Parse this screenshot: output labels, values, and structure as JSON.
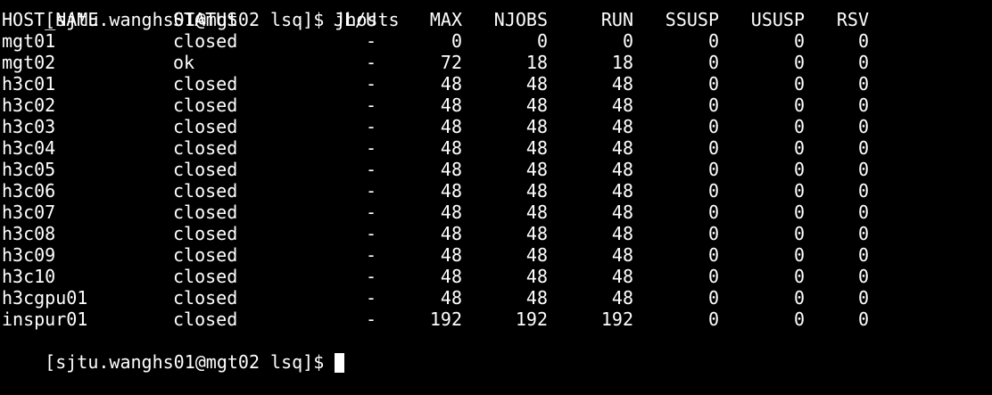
{
  "terminal": {
    "prev_prompt": "[sjtu.wanghs01@mgt02 lsq]$ jhosts",
    "headers": {
      "host_name": "HOST_NAME",
      "status": "STATUS",
      "jlu": "JL/U",
      "max": "MAX",
      "njobs": "NJOBS",
      "run": "RUN",
      "ssusp": "SSUSP",
      "ususp": "USUSP",
      "rsv": "RSV"
    },
    "rows": [
      {
        "host_name": "mgt01",
        "status": "closed",
        "jlu": "-",
        "max": "0",
        "njobs": "0",
        "run": "0",
        "ssusp": "0",
        "ususp": "0",
        "rsv": "0"
      },
      {
        "host_name": "mgt02",
        "status": "ok",
        "jlu": "-",
        "max": "72",
        "njobs": "18",
        "run": "18",
        "ssusp": "0",
        "ususp": "0",
        "rsv": "0"
      },
      {
        "host_name": "h3c01",
        "status": "closed",
        "jlu": "-",
        "max": "48",
        "njobs": "48",
        "run": "48",
        "ssusp": "0",
        "ususp": "0",
        "rsv": "0"
      },
      {
        "host_name": "h3c02",
        "status": "closed",
        "jlu": "-",
        "max": "48",
        "njobs": "48",
        "run": "48",
        "ssusp": "0",
        "ususp": "0",
        "rsv": "0"
      },
      {
        "host_name": "h3c03",
        "status": "closed",
        "jlu": "-",
        "max": "48",
        "njobs": "48",
        "run": "48",
        "ssusp": "0",
        "ususp": "0",
        "rsv": "0"
      },
      {
        "host_name": "h3c04",
        "status": "closed",
        "jlu": "-",
        "max": "48",
        "njobs": "48",
        "run": "48",
        "ssusp": "0",
        "ususp": "0",
        "rsv": "0"
      },
      {
        "host_name": "h3c05",
        "status": "closed",
        "jlu": "-",
        "max": "48",
        "njobs": "48",
        "run": "48",
        "ssusp": "0",
        "ususp": "0",
        "rsv": "0"
      },
      {
        "host_name": "h3c06",
        "status": "closed",
        "jlu": "-",
        "max": "48",
        "njobs": "48",
        "run": "48",
        "ssusp": "0",
        "ususp": "0",
        "rsv": "0"
      },
      {
        "host_name": "h3c07",
        "status": "closed",
        "jlu": "-",
        "max": "48",
        "njobs": "48",
        "run": "48",
        "ssusp": "0",
        "ususp": "0",
        "rsv": "0"
      },
      {
        "host_name": "h3c08",
        "status": "closed",
        "jlu": "-",
        "max": "48",
        "njobs": "48",
        "run": "48",
        "ssusp": "0",
        "ususp": "0",
        "rsv": "0"
      },
      {
        "host_name": "h3c09",
        "status": "closed",
        "jlu": "-",
        "max": "48",
        "njobs": "48",
        "run": "48",
        "ssusp": "0",
        "ususp": "0",
        "rsv": "0"
      },
      {
        "host_name": "h3c10",
        "status": "closed",
        "jlu": "-",
        "max": "48",
        "njobs": "48",
        "run": "48",
        "ssusp": "0",
        "ususp": "0",
        "rsv": "0"
      },
      {
        "host_name": "h3cgpu01",
        "status": "closed",
        "jlu": "-",
        "max": "48",
        "njobs": "48",
        "run": "48",
        "ssusp": "0",
        "ususp": "0",
        "rsv": "0"
      },
      {
        "host_name": "inspur01",
        "status": "closed",
        "jlu": "-",
        "max": "192",
        "njobs": "192",
        "run": "192",
        "ssusp": "0",
        "ususp": "0",
        "rsv": "0"
      }
    ],
    "prompt": "[sjtu.wanghs01@mgt02 lsq]$"
  }
}
